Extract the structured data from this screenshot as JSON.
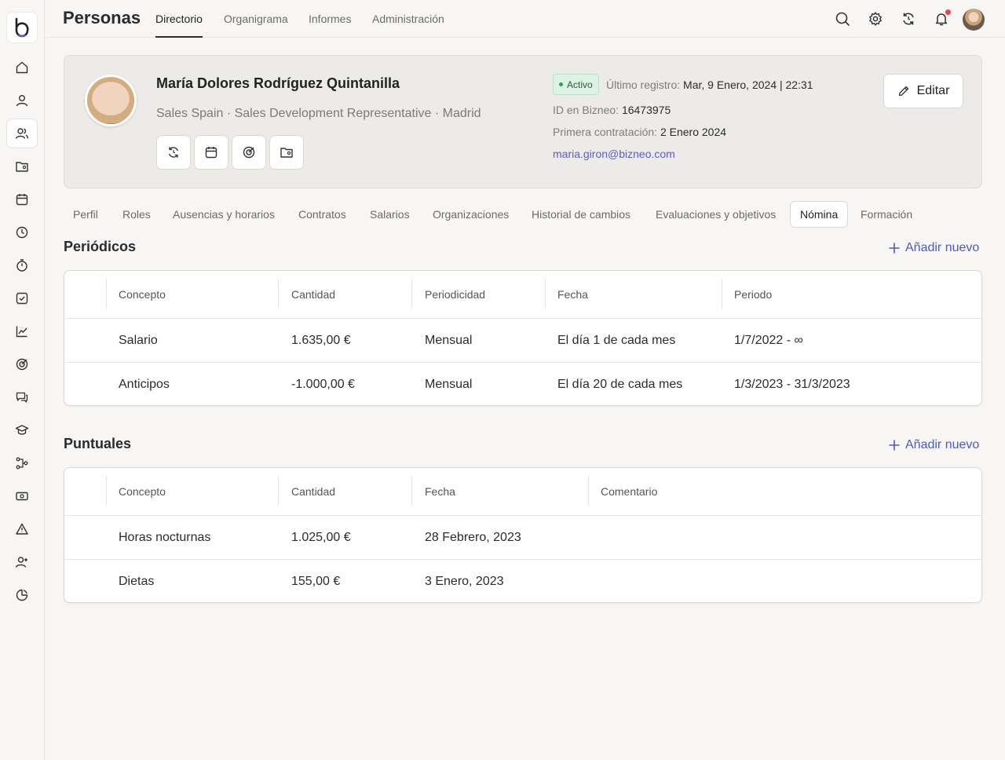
{
  "app": {
    "title": "Personas"
  },
  "nav": {
    "tabs": [
      "Directorio",
      "Organigrama",
      "Informes",
      "Administración"
    ],
    "active": "Directorio"
  },
  "sidebar": {
    "items": [
      "home",
      "user",
      "users",
      "folder-user",
      "calendar",
      "clock",
      "timer",
      "check-square",
      "chart",
      "target",
      "chat",
      "graduation-cap",
      "workflow",
      "payslip",
      "alert",
      "user-plus",
      "pie"
    ],
    "active": "users"
  },
  "topbar": {
    "icons": [
      "search-icon",
      "gear-icon",
      "sync-icon",
      "bell-icon"
    ]
  },
  "profile": {
    "name": "María Dolores Rodríguez Quintanilla",
    "subtitle": "Sales Spain · Sales Development Representative · Madrid",
    "status": "Activo",
    "last_record_label": "Último registro:",
    "last_record_value": "Mar, 9 Enero, 2024 | 22:31",
    "id_label": "ID en Bizneo:",
    "id_value": "16473975",
    "hire_label": "Primera contratación:",
    "hire_value": "2 Enero 2024",
    "email": "maria.giron@bizneo.com",
    "edit_label": "Editar"
  },
  "section_tabs": [
    "Perfil",
    "Roles",
    "Ausencias y horarios",
    "Contratos",
    "Salarios",
    "Organizaciones",
    "Historial de cambios",
    "Evaluaciones y objetivos",
    "Nómina",
    "Formación"
  ],
  "periodic": {
    "title": "Periódicos",
    "add_label": "Añadir nuevo",
    "headers": [
      "Concepto",
      "Cantidad",
      "Periodicidad",
      "Fecha",
      "Periodo"
    ],
    "rows": [
      [
        "Salario",
        "1.635,00 €",
        "Mensual",
        "El día 1 de cada mes",
        "1/7/2022 - ∞"
      ],
      [
        "Anticipos",
        "-1.000,00 €",
        "Mensual",
        "El día 20 de cada mes",
        "1/3/2023 - 31/3/2023"
      ]
    ]
  },
  "oneoff": {
    "title": "Puntuales",
    "add_label": "Añadir nuevo",
    "headers": [
      "Concepto",
      "Cantidad",
      "Fecha",
      "Comentario"
    ],
    "rows": [
      [
        "Horas nocturnas",
        "1.025,00 €",
        "28 Febrero, 2023",
        ""
      ],
      [
        "Dietas",
        "155,00 €",
        "3 Enero, 2023",
        ""
      ]
    ]
  }
}
